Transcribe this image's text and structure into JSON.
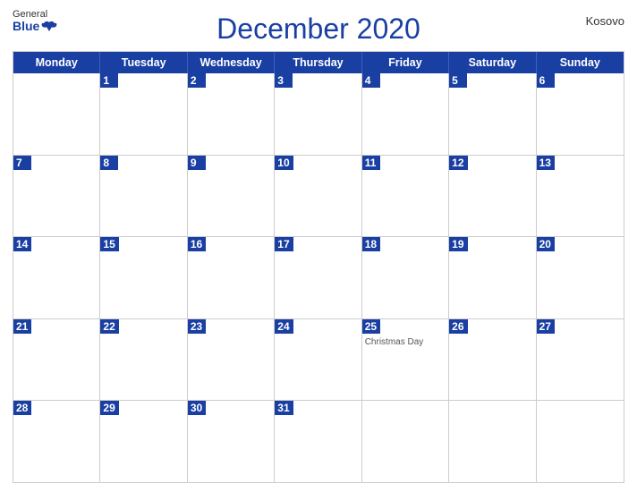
{
  "header": {
    "logo_general": "General",
    "logo_blue": "Blue",
    "title": "December 2020",
    "country": "Kosovo"
  },
  "day_headers": [
    "Monday",
    "Tuesday",
    "Wednesday",
    "Thursday",
    "Friday",
    "Saturday",
    "Sunday"
  ],
  "weeks": [
    [
      {
        "day": "",
        "empty": true
      },
      {
        "day": "1"
      },
      {
        "day": "2"
      },
      {
        "day": "3"
      },
      {
        "day": "4"
      },
      {
        "day": "5"
      },
      {
        "day": "6"
      }
    ],
    [
      {
        "day": "7"
      },
      {
        "day": "8"
      },
      {
        "day": "9"
      },
      {
        "day": "10"
      },
      {
        "day": "11"
      },
      {
        "day": "12"
      },
      {
        "day": "13"
      }
    ],
    [
      {
        "day": "14"
      },
      {
        "day": "15"
      },
      {
        "day": "16"
      },
      {
        "day": "17"
      },
      {
        "day": "18"
      },
      {
        "day": "19"
      },
      {
        "day": "20"
      }
    ],
    [
      {
        "day": "21"
      },
      {
        "day": "22"
      },
      {
        "day": "23"
      },
      {
        "day": "24"
      },
      {
        "day": "25",
        "event": "Christmas Day"
      },
      {
        "day": "26"
      },
      {
        "day": "27"
      }
    ],
    [
      {
        "day": "28"
      },
      {
        "day": "29"
      },
      {
        "day": "30"
      },
      {
        "day": "31"
      },
      {
        "day": "",
        "empty": true
      },
      {
        "day": "",
        "empty": true
      },
      {
        "day": "",
        "empty": true
      }
    ]
  ]
}
